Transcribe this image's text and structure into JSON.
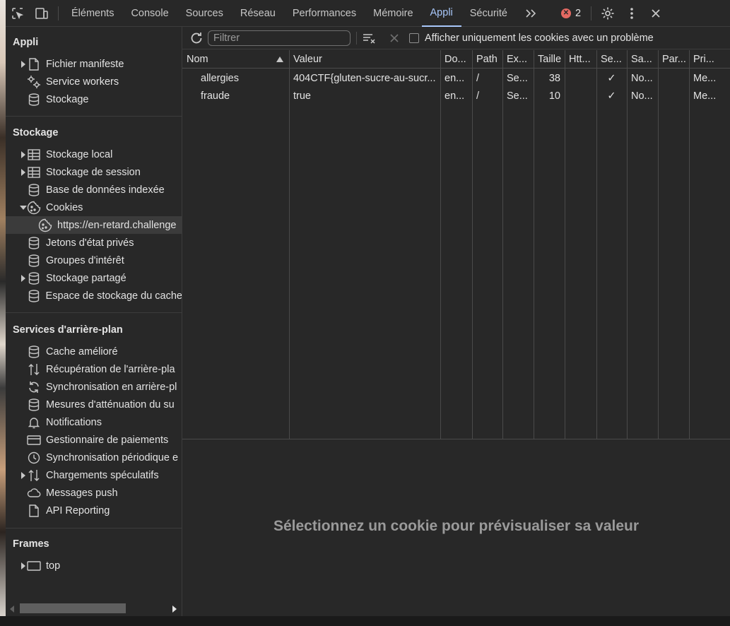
{
  "toolbar": {
    "tabs": [
      "Éléments",
      "Console",
      "Sources",
      "Réseau",
      "Performances",
      "Mémoire",
      "Appli",
      "Sécurité"
    ],
    "active_tab": "Appli",
    "error_count": "2"
  },
  "sidebar": {
    "appli": {
      "title": "Appli",
      "items": [
        "Fichier manifeste",
        "Service workers",
        "Stockage"
      ]
    },
    "stockage": {
      "title": "Stockage",
      "items": [
        "Stockage local",
        "Stockage de session",
        "Base de données indexée",
        "Cookies",
        "https://en-retard.challenge",
        "Jetons d'état privés",
        "Groupes d'intérêt",
        "Stockage partagé",
        "Espace de stockage du cache"
      ]
    },
    "services": {
      "title": "Services d'arrière-plan",
      "items": [
        "Cache amélioré",
        "Récupération de l'arrière-pla",
        "Synchronisation en arrière-pl",
        "Mesures d'atténuation du su",
        "Notifications",
        "Gestionnaire de paiements",
        "Synchronisation périodique e",
        "Chargements spéculatifs",
        "Messages push",
        "API Reporting"
      ]
    },
    "frames": {
      "title": "Frames",
      "items": [
        "top"
      ]
    }
  },
  "filterbar": {
    "placeholder": "Filtrer",
    "checkbox_label": "Afficher uniquement les cookies avec un problème"
  },
  "table": {
    "headers": [
      "Nom",
      "Valeur",
      "Do...",
      "Path",
      "Ex...",
      "Taille",
      "Htt...",
      "Se...",
      "Sa...",
      "Par...",
      "Pri..."
    ],
    "rows": [
      [
        "allergies",
        "404CTF{gluten-sucre-au-sucr...",
        "en...",
        "/",
        "Se...",
        "38",
        "",
        "✓",
        "No...",
        "",
        "Me..."
      ],
      [
        "fraude",
        "true",
        "en...",
        "/",
        "Se...",
        "10",
        "",
        "✓",
        "No...",
        "",
        "Me..."
      ]
    ]
  },
  "preview": {
    "message": "Sélectionnez un cookie pour prévisualiser sa valeur"
  },
  "colors": {
    "accent": "#a8c7fa",
    "error": "#e46962",
    "background": "#282828"
  }
}
